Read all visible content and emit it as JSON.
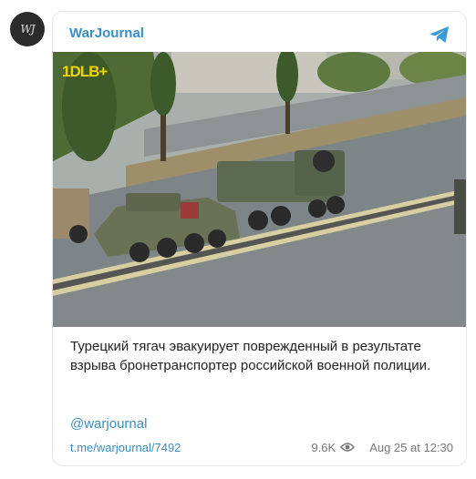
{
  "channel": {
    "avatar_text": "WJ",
    "name": "WarJournal"
  },
  "post": {
    "image_logo_text": "1DLB+",
    "text": "Турецкий тягач эвакуирует поврежденный в результате взрыва бронетранспортер российской военной полиции.",
    "handle": "@warjournal",
    "link": "t.me/warjournal/7492",
    "views": "9.6K",
    "date": "Aug 25 at 12:30"
  },
  "icons": {
    "platform": "telegram-icon",
    "views": "eye-icon"
  },
  "colors": {
    "accent": "#3a8ec2",
    "logo_yellow": "#f2d200"
  }
}
